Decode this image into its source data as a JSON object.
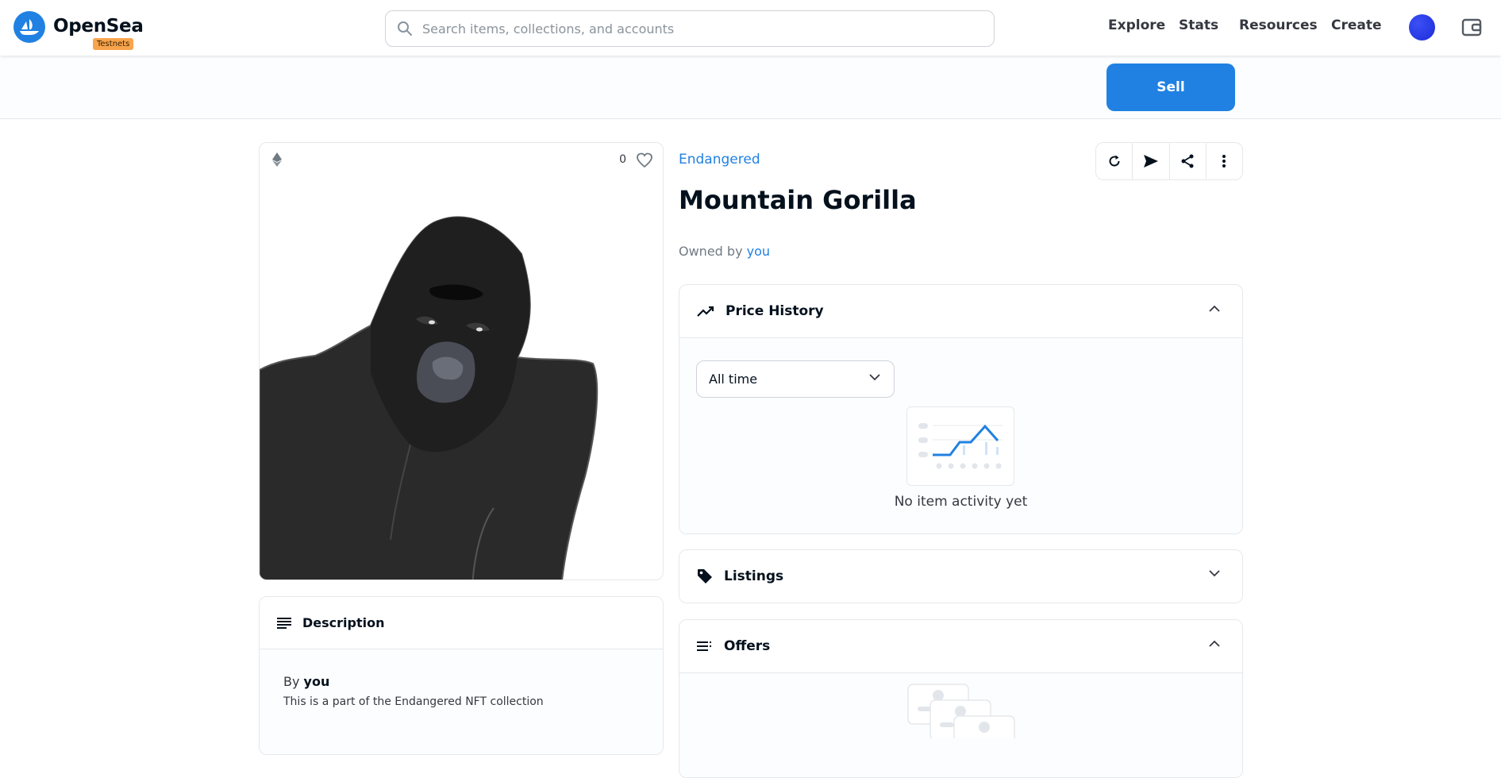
{
  "header": {
    "brand": "OpenSea",
    "badge": "Testnets",
    "search_placeholder": "Search items, collections, and accounts",
    "nav": [
      "Explore",
      "Stats",
      "Resources",
      "Create"
    ]
  },
  "actions": {
    "sell_label": "Sell"
  },
  "item": {
    "likes": "0",
    "collection": "Endangered",
    "title": "Mountain Gorilla",
    "owned_prefix": "Owned by",
    "owner": "you"
  },
  "description": {
    "heading": "Description",
    "by_prefix": "By",
    "by_name": "you",
    "text": "This is a part of the Endangered NFT collection"
  },
  "price_history": {
    "heading": "Price History",
    "range_selected": "All time",
    "empty_text": "No item activity yet"
  },
  "listings": {
    "heading": "Listings"
  },
  "offers": {
    "heading": "Offers"
  },
  "colors": {
    "accent": "#2081e2",
    "badge": "#f8a44d",
    "border": "#e5e8eb"
  }
}
